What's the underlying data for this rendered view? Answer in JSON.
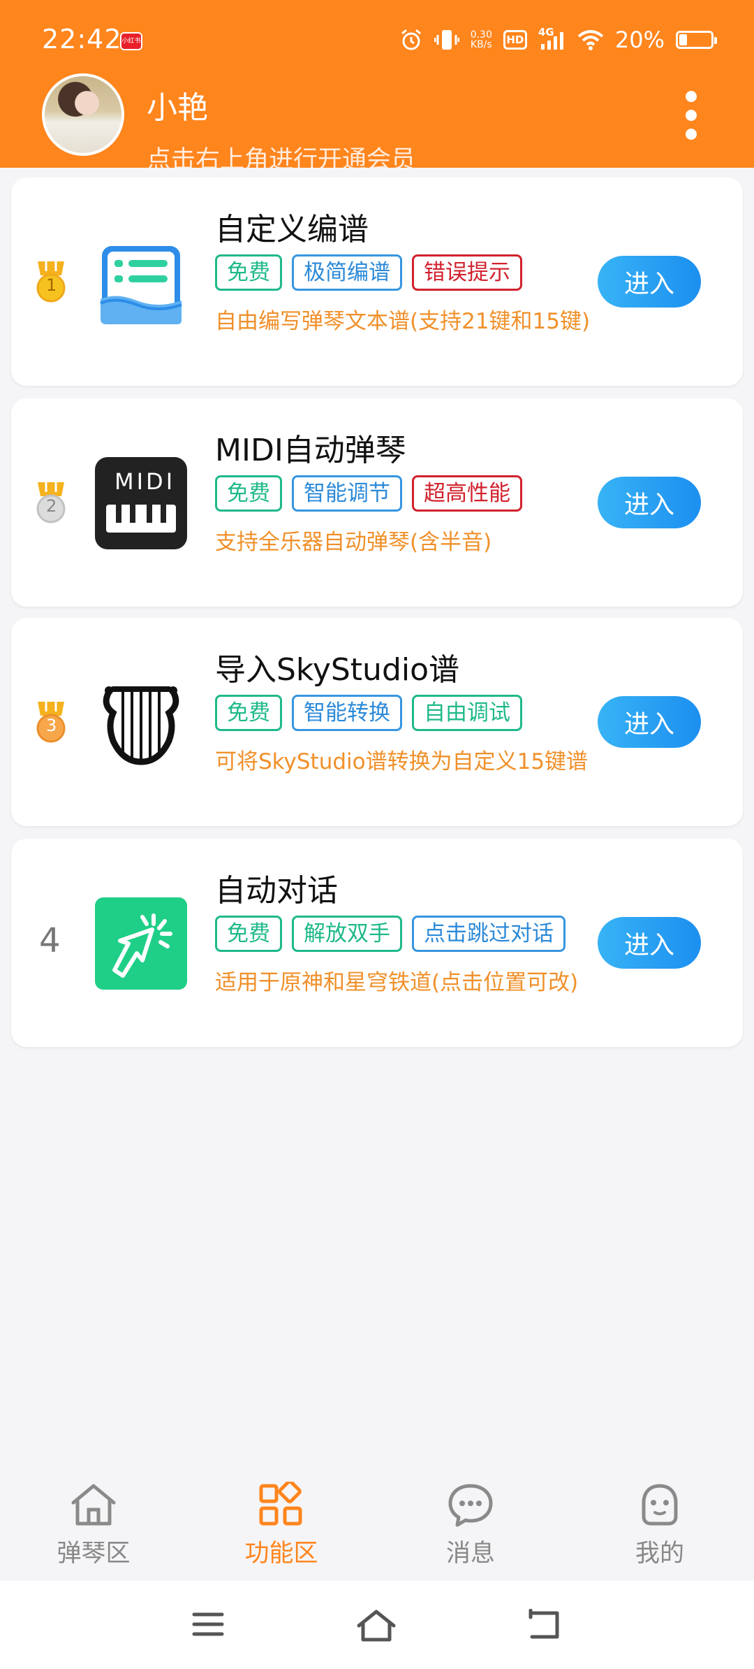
{
  "status_bar": {
    "time": "22:42",
    "notif_app": "小红书",
    "net_speed_value": "0.30",
    "net_speed_unit": "KB/s",
    "hd": "HD",
    "signal": "4G",
    "battery": "20%",
    "battery_level": 0.2
  },
  "user": {
    "name": "小艳",
    "subtitle": "点击右上角进行开通会员"
  },
  "features": [
    {
      "rank": "1",
      "title": "自定义编谱",
      "tags": [
        {
          "label": "免费",
          "color": "green"
        },
        {
          "label": "极简编谱",
          "color": "blue"
        },
        {
          "label": "错误提示",
          "color": "red"
        }
      ],
      "description": "自由编写弹琴文本谱(支持21键和15键)",
      "button": "进入",
      "icon": "score-editor-icon"
    },
    {
      "rank": "2",
      "title": "MIDI自动弹琴",
      "tags": [
        {
          "label": "免费",
          "color": "green"
        },
        {
          "label": "智能调节",
          "color": "blue"
        },
        {
          "label": "超高性能",
          "color": "red"
        }
      ],
      "description": "支持全乐器自动弹琴(含半音)",
      "button": "进入",
      "icon": "midi-keyboard-icon",
      "icon_text": "MIDI"
    },
    {
      "rank": "3",
      "title": "导入SkyStudio谱",
      "tags": [
        {
          "label": "免费",
          "color": "green"
        },
        {
          "label": "智能转换",
          "color": "blue"
        },
        {
          "label": "自由调试",
          "color": "green"
        }
      ],
      "description": "可将SkyStudio谱转换为自定义15键谱",
      "button": "进入",
      "icon": "lyre-icon"
    },
    {
      "rank": "4",
      "title": "自动对话",
      "tags": [
        {
          "label": "免费",
          "color": "green"
        },
        {
          "label": "解放双手",
          "color": "green"
        },
        {
          "label": "点击跳过对话",
          "color": "blue"
        }
      ],
      "description": "适用于原神和星穹铁道(点击位置可改)",
      "button": "进入",
      "icon": "auto-click-icon"
    }
  ],
  "bottom_nav": [
    {
      "label": "弹琴区",
      "icon": "home-icon",
      "active": false
    },
    {
      "label": "功能区",
      "icon": "grid-icon",
      "active": true
    },
    {
      "label": "消息",
      "icon": "chat-icon",
      "active": false
    },
    {
      "label": "我的",
      "icon": "profile-icon",
      "active": false
    }
  ],
  "colors": {
    "accent": "#ff851d",
    "button": "#1c8ff0",
    "desc": "#f0902a",
    "tag_green": "#1fb98a",
    "tag_blue": "#2c8ad8",
    "tag_red": "#d1222e"
  }
}
